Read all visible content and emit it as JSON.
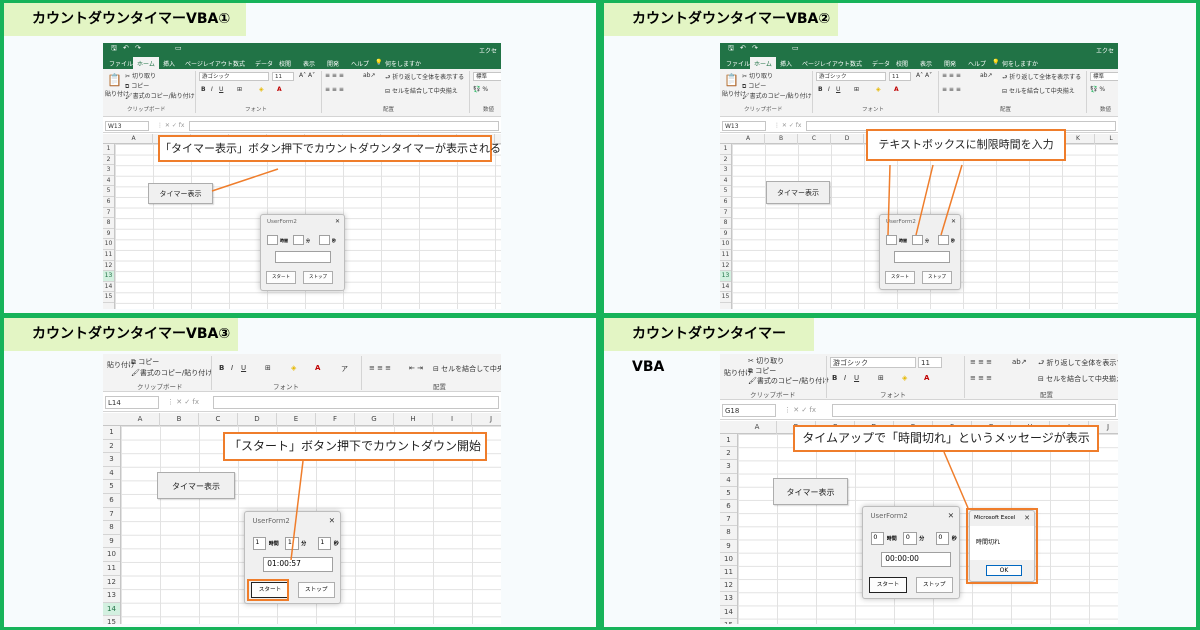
{
  "titles": [
    "カウントダウンタイマーVBA①",
    "カウントダウンタイマーVBA②",
    "カウントダウンタイマーVBA③",
    "カウントダウンタイマーVBA"
  ],
  "ribbon": {
    "tabs": [
      "ファイル",
      "ホーム",
      "挿入",
      "ページレイアウト",
      "数式",
      "データ",
      "校閲",
      "表示",
      "開発",
      "ヘルプ"
    ],
    "search": "何をしますか",
    "app_short": "エクセ",
    "cut": "切り取り",
    "copy": "コピー",
    "format_painter": "書式のコピー/貼り付け",
    "paste": "貼り付け",
    "clipboard": "クリップボード",
    "font_name": "游ゴシック",
    "font_size": "11",
    "font_group": "フォント",
    "wrap": "折り返して全体を表示する",
    "wrap_short": "折り返して全体を表示す",
    "merge": "セルを結合して中央揃え",
    "merge_short": "セルを結合して中央",
    "align_group": "配置",
    "number_format": "標準",
    "number_group": "数値"
  },
  "namebox": [
    "W13",
    "W13",
    "L14",
    "G18"
  ],
  "columns": [
    "A",
    "B",
    "C",
    "D",
    "E",
    "F",
    "G",
    "H",
    "I",
    "J",
    "K",
    "L"
  ],
  "sheet_button": "タイマー表示",
  "form": {
    "title": "UserForm2",
    "close": "✕",
    "hour": "時間",
    "minute": "分",
    "second": "秒",
    "start": "スタート",
    "stop": "ストップ",
    "p3": {
      "h": "1",
      "m": "1",
      "s": "1",
      "display": "01:00:57"
    },
    "p4": {
      "h": "0",
      "m": "0",
      "s": "0",
      "display": "00:00:00"
    }
  },
  "msgbox": {
    "title": "Microsoft Excel",
    "text": "時間切れ",
    "ok": "OK"
  },
  "callouts": [
    "「タイマー表示」ボタン押下でカウントダウンタイマーが表示される",
    "テキストボックスに制限時間を入力",
    "「スタート」ボタン押下でカウントダウン開始",
    "タイムアップで「時間切れ」というメッセージが表示"
  ],
  "colors": {
    "frame": "#17b35a",
    "title_bg": "#e3f5c4",
    "excel_green": "#217346",
    "accent": "#ef7d2b"
  }
}
